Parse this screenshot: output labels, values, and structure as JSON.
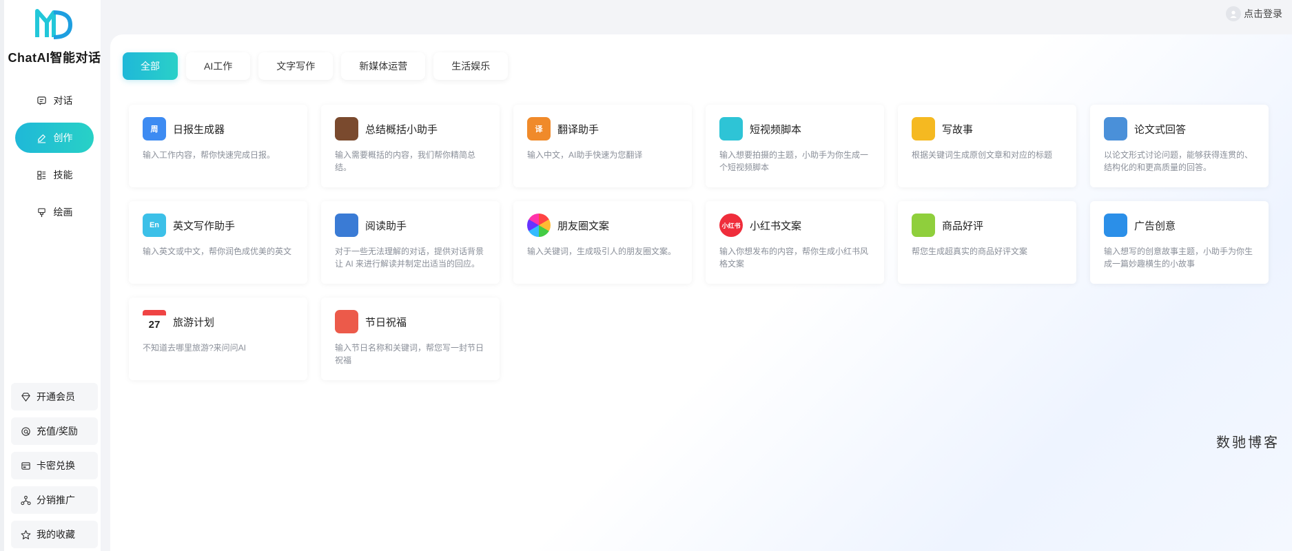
{
  "app": {
    "brand": "ChatAI智能对话"
  },
  "header": {
    "login_label": "点击登录"
  },
  "sidebar": {
    "nav": [
      {
        "label": "对话",
        "icon": "chat-icon"
      },
      {
        "label": "创作",
        "icon": "edit-icon",
        "active": true
      },
      {
        "label": "技能",
        "icon": "skills-icon"
      },
      {
        "label": "绘画",
        "icon": "paint-brush-icon"
      }
    ],
    "bottom": [
      {
        "label": "开通会员",
        "icon": "diamond-icon"
      },
      {
        "label": "充值/奖励",
        "icon": "recharge-icon"
      },
      {
        "label": "卡密兑换",
        "icon": "card-icon"
      },
      {
        "label": "分销推广",
        "icon": "share-network-icon"
      },
      {
        "label": "我的收藏",
        "icon": "star-icon"
      }
    ]
  },
  "tabs": [
    {
      "label": "全部",
      "active": true
    },
    {
      "label": "AI工作"
    },
    {
      "label": "文字写作"
    },
    {
      "label": "新媒体运营"
    },
    {
      "label": "生活娱乐"
    }
  ],
  "cards": [
    {
      "title": "日报生成器",
      "desc": "输入工作内容，帮你快速完成日报。",
      "icon": "calendar-report-icon",
      "icon_text": "周",
      "color": "#3d8bf2"
    },
    {
      "title": "总结概括小助手",
      "desc": "输入需要概括的内容，我们帮你精简总结。",
      "icon": "briefcase-icon",
      "icon_text": "",
      "color": "#7a4a2e"
    },
    {
      "title": "翻译助手",
      "desc": "输入中文，AI助手快速为您翻译",
      "icon": "translate-icon",
      "icon_text": "译",
      "color": "#f08a2a"
    },
    {
      "title": "短视频脚本",
      "desc": "输入想要拍摄的主题，小助手为你生成一个短视频脚本",
      "icon": "clapperboard-icon",
      "icon_text": "",
      "color": "#2ec4d6"
    },
    {
      "title": "写故事",
      "desc": "根据关键词生成原创文章和对应的标题",
      "icon": "notepad-pen-icon",
      "icon_text": "",
      "color": "#f5b921"
    },
    {
      "title": "论文式回答",
      "desc": "以论文形式讨论问题，能够获得连贯的、结构化的和更高质量的回答。",
      "icon": "binders-icon",
      "icon_text": "",
      "color": "#4a90d9"
    },
    {
      "title": "英文写作助手",
      "desc": "输入英文或中文，帮你润色成优美的英文",
      "icon": "english-icon",
      "icon_text": "En",
      "color": "#3cc0e8"
    },
    {
      "title": "阅读助手",
      "desc": "对于一些无法理解的对话，提供对话背景让 AI 来进行解读并制定出适当的回应。",
      "icon": "books-icon",
      "icon_text": "",
      "color": "#3a7bd5"
    },
    {
      "title": "朋友圈文案",
      "desc": "输入关键词，生成吸引人的朋友圈文案。",
      "icon": "moments-icon",
      "icon_text": "",
      "color": "#ffffff"
    },
    {
      "title": "小红书文案",
      "desc": "输入你想发布的内容，帮你生成小红书风格文案",
      "icon": "xiaohongshu-icon",
      "icon_text": "小红书",
      "color": "#ef2d3b"
    },
    {
      "title": "商品好评",
      "desc": "帮您生成超真实的商品好评文案",
      "icon": "shopping-bag-icon",
      "icon_text": "",
      "color": "#8fcf3c"
    },
    {
      "title": "广告创意",
      "desc": "输入想写的创意故事主题，小助手为你生成一篇妙趣横生的小故事",
      "icon": "lightbulb-icon",
      "icon_text": "",
      "color": "#2b8fe8"
    },
    {
      "title": "旅游计划",
      "desc": "不知道去哪里旅游?来问问AI",
      "icon": "calendar-27-icon",
      "icon_text": "27",
      "color": "#ffffff"
    },
    {
      "title": "节日祝福",
      "desc": "输入节日名称和关键词，帮您写一封节日祝福",
      "icon": "festival-icon",
      "icon_text": "",
      "color": "#ec5a4a"
    }
  ],
  "watermark": "数驰博客"
}
